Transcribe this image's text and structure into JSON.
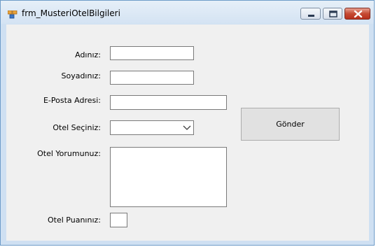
{
  "window": {
    "title": "frm_MusteriOtelBilgileri",
    "icons": {
      "app": "winforms-app-icon",
      "minimize": "minimize-icon",
      "maximize": "maximize-icon",
      "close": "close-icon"
    },
    "colors": {
      "frame": "#cfe0f2",
      "client": "#f0f0f0",
      "close_button": "#c54a33",
      "button_face": "#e1e1e1"
    }
  },
  "form": {
    "name_label": "Adınız:",
    "name_value": "",
    "surname_label": "Soyadınız:",
    "surname_value": "",
    "email_label": "E-Posta Adresi:",
    "email_value": "",
    "hotel_label": "Otel Seçiniz:",
    "hotel_selected": "",
    "comment_label": "Otel Yorumunuz:",
    "comment_value": "",
    "rating_label": "Otel Puanınız:",
    "rating_value": "",
    "submit_label": "Gönder",
    "combo_icon": "chevron-down-icon"
  }
}
